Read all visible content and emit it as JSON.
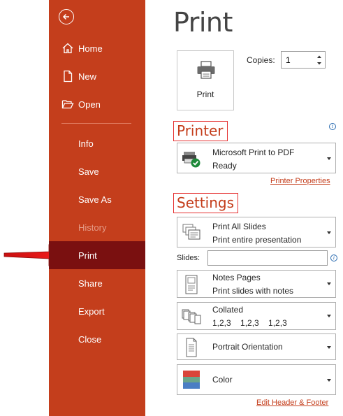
{
  "sidebar": {
    "items": [
      {
        "label": "Home",
        "icon": "home-icon"
      },
      {
        "label": "New",
        "icon": "new-document-icon"
      },
      {
        "label": "Open",
        "icon": "open-folder-icon"
      },
      {
        "label": "Info"
      },
      {
        "label": "Save"
      },
      {
        "label": "Save As"
      },
      {
        "label": "History",
        "disabled": true
      },
      {
        "label": "Print",
        "active": true
      },
      {
        "label": "Share"
      },
      {
        "label": "Export"
      },
      {
        "label": "Close"
      }
    ],
    "bg_color": "#c43e1c",
    "active_color": "#7a1010"
  },
  "main": {
    "title": "Print",
    "print_button_label": "Print",
    "copies_label": "Copies:",
    "copies_value": "1",
    "printer_section": "Printer",
    "printer_name": "Microsoft Print to PDF",
    "printer_status": "Ready",
    "printer_properties": "Printer Properties",
    "settings_section": "Settings",
    "slides_range": {
      "line1": "Print All Slides",
      "line2": "Print entire presentation"
    },
    "slides_label": "Slides:",
    "slides_value": "",
    "layout": {
      "line1": "Notes Pages",
      "line2": "Print slides with notes"
    },
    "collation": {
      "line1": "Collated",
      "line2": "1,2,3    1,2,3    1,2,3"
    },
    "orientation": {
      "line1": "Portrait Orientation"
    },
    "color": {
      "line1": "Color"
    },
    "edit_header_footer": "Edit Header & Footer",
    "accent_color": "#c43e1c"
  }
}
